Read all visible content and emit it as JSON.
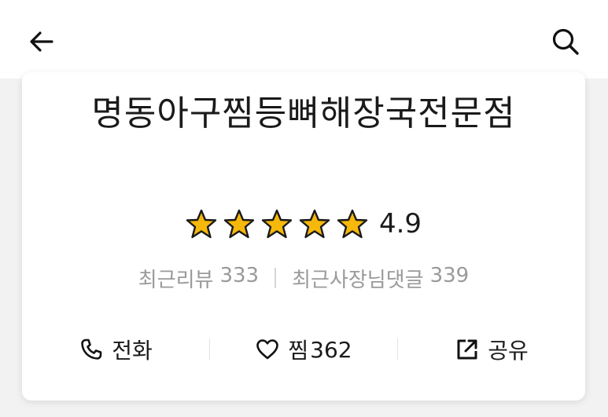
{
  "header": {
    "back_icon": "arrow-left-icon",
    "search_icon": "search-icon"
  },
  "store": {
    "name": "명동아구찜등뼈해장국전문점",
    "rating": "4.9",
    "stars": 5,
    "star_color": "#f5b80b",
    "recent_reviews_label": "최근리뷰",
    "recent_reviews_count": "333",
    "owner_replies_label": "최근사장님댓글",
    "owner_replies_count": "339"
  },
  "actions": {
    "call_label": "전화",
    "call_icon": "phone-icon",
    "favorite_label": "찜",
    "favorite_count": "362",
    "favorite_icon": "heart-icon",
    "share_label": "공유",
    "share_icon": "share-icon"
  }
}
